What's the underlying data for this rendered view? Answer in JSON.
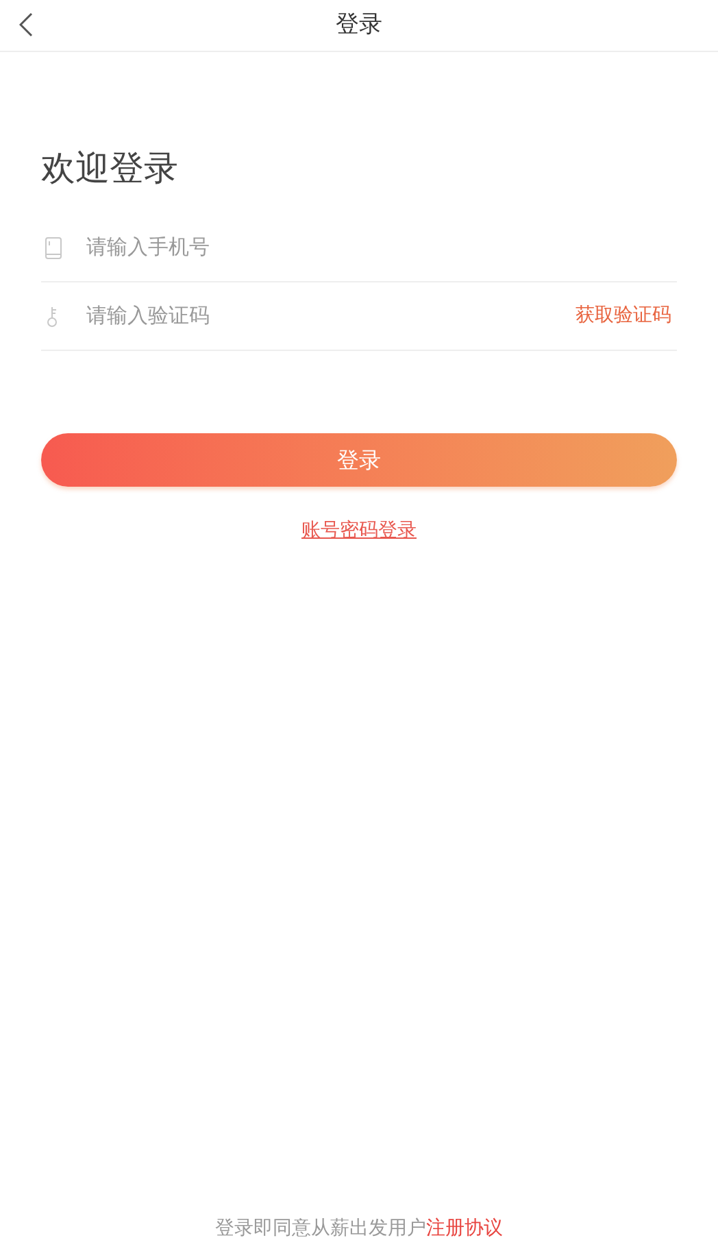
{
  "header": {
    "title": "登录"
  },
  "heading": "欢迎登录",
  "fields": [
    {
      "kind": "phone",
      "placeholder": "请输入手机号"
    },
    {
      "kind": "code",
      "placeholder": "请输入验证码",
      "action": "获取验证码"
    }
  ],
  "login_button": "登录",
  "alt_login_link": "账号密码登录",
  "footer": {
    "text": "登录即同意从薪出发用户",
    "link": "注册协议"
  }
}
